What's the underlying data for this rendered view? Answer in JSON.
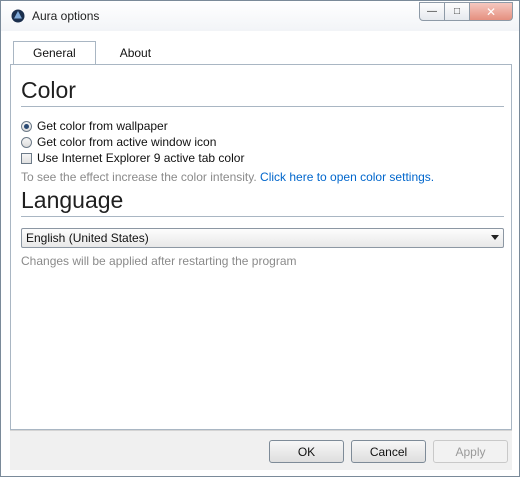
{
  "window": {
    "title": "Aura options"
  },
  "tabs": [
    {
      "label": "General"
    },
    {
      "label": "About"
    }
  ],
  "color_section": {
    "title": "Color",
    "options": [
      {
        "label": "Get color from wallpaper",
        "checked": true
      },
      {
        "label": "Get color from active window icon",
        "checked": false
      }
    ],
    "checkbox": {
      "label": "Use Internet Explorer 9 active tab color",
      "checked": false
    },
    "hint": "To see the effect increase the color intensity.",
    "link": "Click here to open color settings."
  },
  "language_section": {
    "title": "Language",
    "selected": "English (United States)",
    "note": "Changes will be applied after restarting the program"
  },
  "buttons": {
    "ok": "OK",
    "cancel": "Cancel",
    "apply": "Apply"
  }
}
